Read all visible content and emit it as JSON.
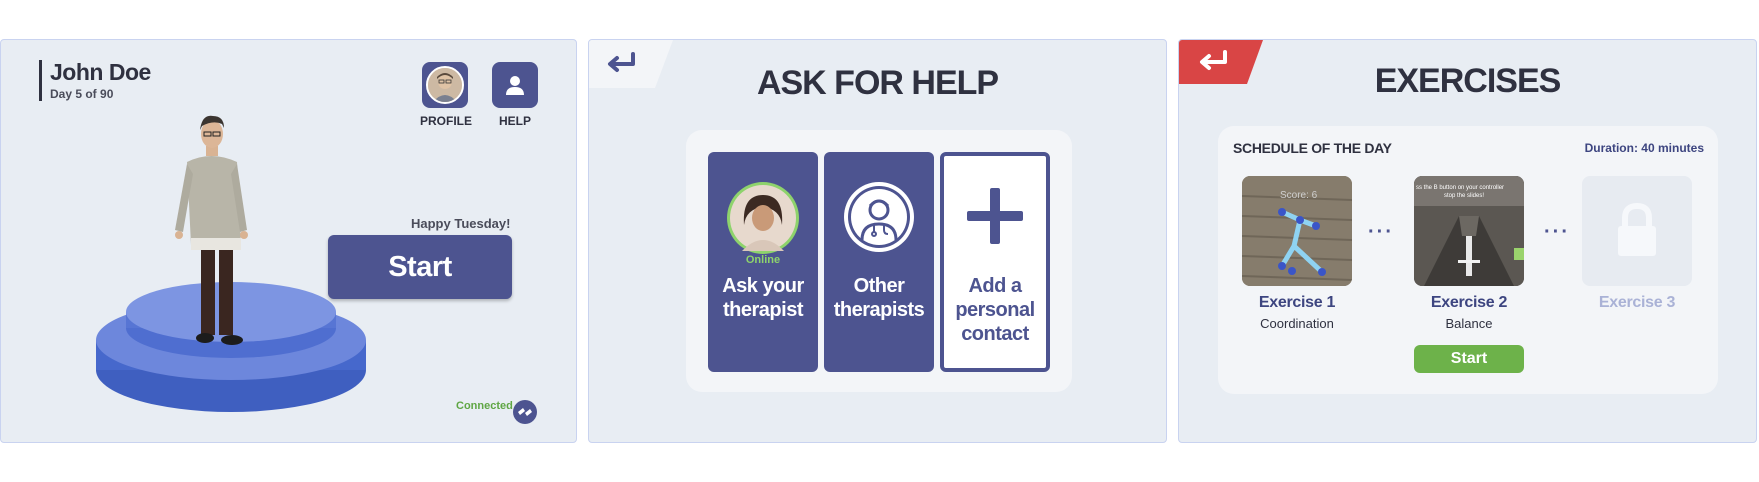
{
  "home": {
    "user_name": "John Doe",
    "day_progress": "Day 5 of 90",
    "profile_label": "PROFILE",
    "help_label": "HELP",
    "greeting": "Happy Tuesday!",
    "start_label": "Start",
    "connection_status": "Connected"
  },
  "ask_for_help": {
    "title": "ASK FOR HELP",
    "cards": [
      {
        "status": "Online",
        "label_line1": "Ask your",
        "label_line2": "therapist"
      },
      {
        "label_line1": "Other",
        "label_line2": "therapists"
      },
      {
        "label_line1": "Add a",
        "label_line2": "personal",
        "label_line3": "contact"
      }
    ]
  },
  "exercises": {
    "title": "EXERCISES",
    "schedule_title": "SCHEDULE OF THE DAY",
    "duration": "Duration: 40 minutes",
    "items": [
      {
        "name": "Exercise 1",
        "category": "Coordination",
        "thumb_text": "Score: 6",
        "locked": false
      },
      {
        "name": "Exercise 2",
        "category": "Balance",
        "thumb_text_line1": "ss the B button on your controller",
        "thumb_text_line2": "stop the slides!",
        "locked": false
      },
      {
        "name": "Exercise 3",
        "locked": true
      }
    ],
    "start_label": "Start",
    "separator": "···"
  },
  "colors": {
    "primary": "#4d5490",
    "panel_bg": "#e8edf3",
    "online_green": "#8ed36c",
    "start_green": "#6db24a",
    "back_red": "#d94545",
    "back_light": "#f3f5f8"
  },
  "icons": [
    "back-arrow-icon",
    "user-icon",
    "doctor-icon",
    "plus-icon",
    "link-icon",
    "lock-icon"
  ]
}
